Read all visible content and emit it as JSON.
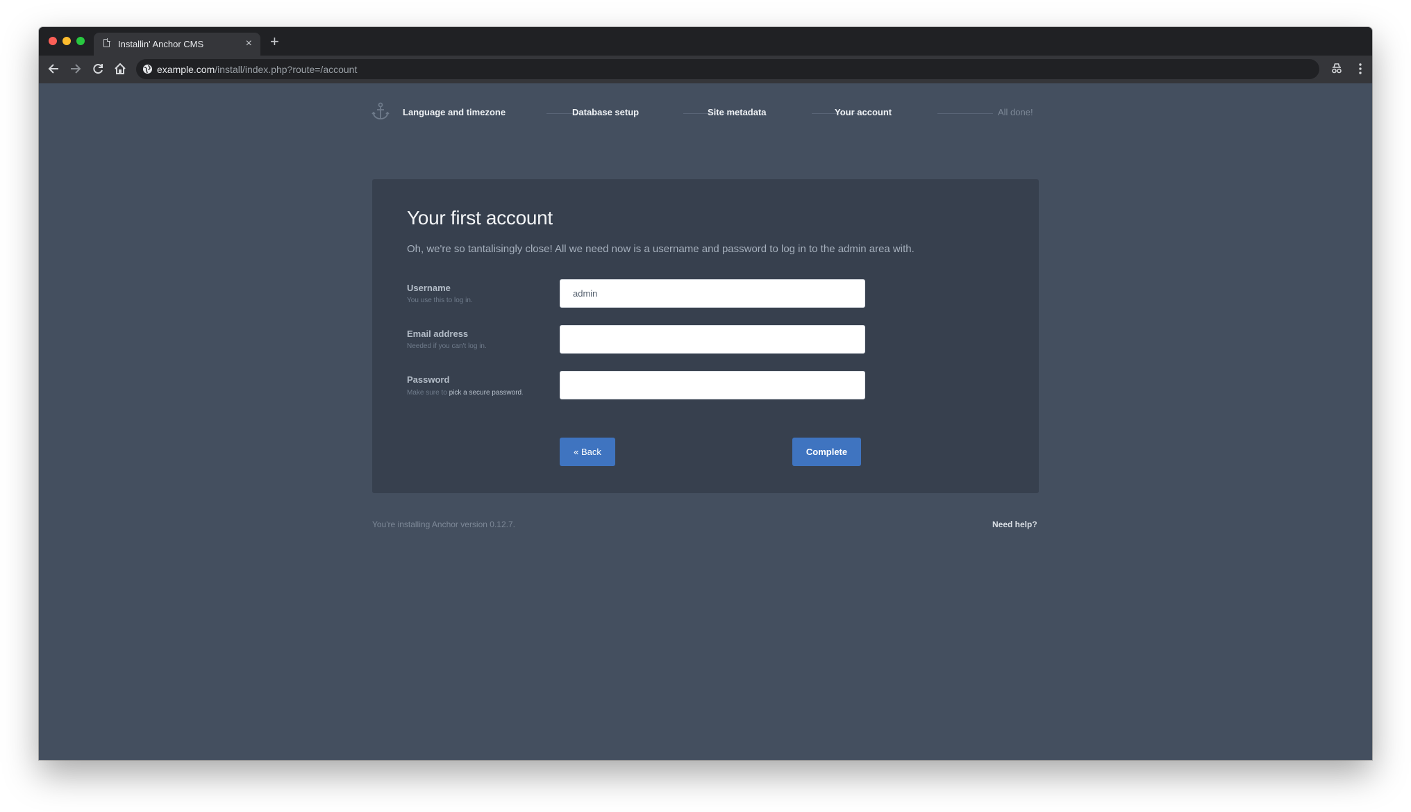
{
  "browser": {
    "tab_title": "Installin' Anchor CMS",
    "tab_close": "×",
    "new_tab": "+",
    "url_host": "example.com",
    "url_path": "/install/index.php?route=/account"
  },
  "steps": [
    {
      "label": "Language and timezone",
      "state": "done"
    },
    {
      "label": "Database setup",
      "state": "done"
    },
    {
      "label": "Site metadata",
      "state": "done"
    },
    {
      "label": "Your account",
      "state": "current"
    },
    {
      "label": "All done!",
      "state": "pending"
    }
  ],
  "card": {
    "title": "Your first account",
    "intro": "Oh, we're so tantalisingly close! All we need now is a username and password to log in to the admin area with."
  },
  "fields": {
    "username": {
      "label": "Username",
      "help": "You use this to log in.",
      "value": "admin"
    },
    "email": {
      "label": "Email address",
      "help": "Needed if you can't log in.",
      "value": ""
    },
    "password": {
      "label": "Password",
      "help_prefix": "Make sure to ",
      "help_link": "pick a secure password",
      "help_suffix": ".",
      "value": ""
    }
  },
  "buttons": {
    "back": "« Back",
    "complete": "Complete"
  },
  "footer": {
    "version_text": "You're installing Anchor version 0.12.7.",
    "help_link": "Need help?"
  },
  "colors": {
    "page_bg": "#444f5f",
    "card_bg": "#37404e",
    "button": "#3f74c0"
  }
}
